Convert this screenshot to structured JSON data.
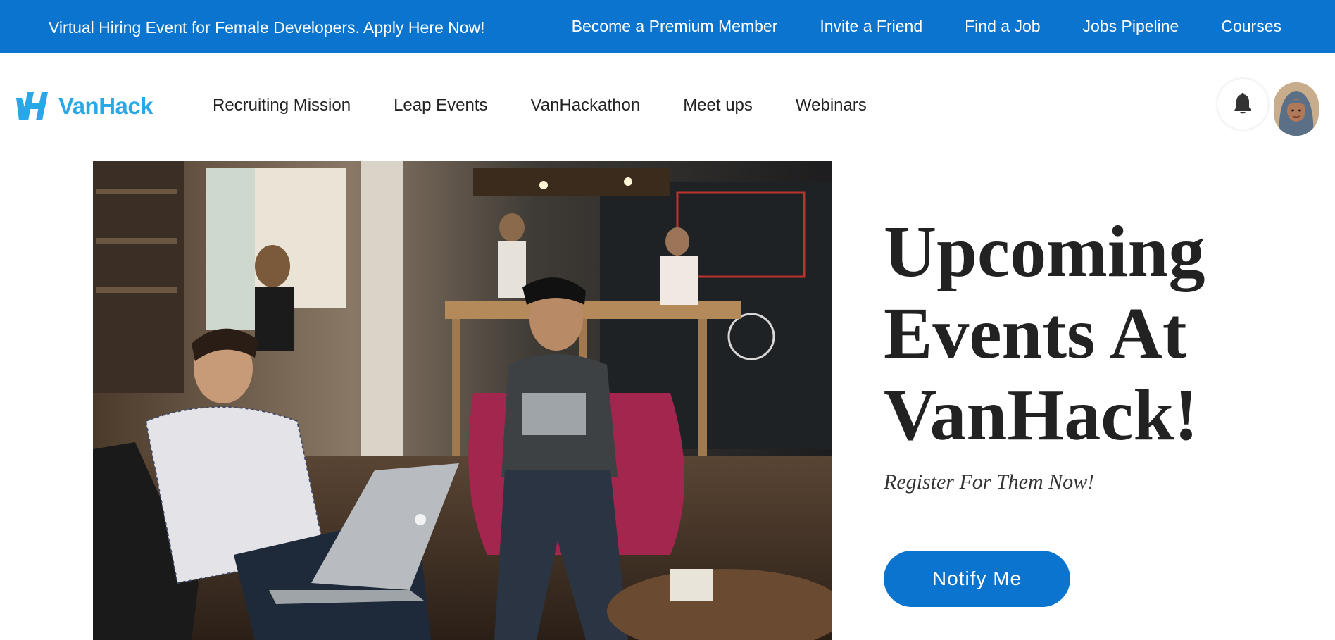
{
  "announcement": {
    "promo_text": "Virtual Hiring Event for Female Developers. Apply Here Now!"
  },
  "top_links": [
    {
      "label": "Become a Premium Member"
    },
    {
      "label": "Invite a Friend"
    },
    {
      "label": "Find a Job"
    },
    {
      "label": "Jobs Pipeline"
    },
    {
      "label": "Courses"
    }
  ],
  "brand": {
    "name": "VanHack",
    "color": "#29a8e8",
    "logo_icon": "vanhack-logo-icon"
  },
  "main_nav": [
    {
      "label": "Recruiting Mission"
    },
    {
      "label": "Leap Events"
    },
    {
      "label": "VanHackathon"
    },
    {
      "label": "Meet ups"
    },
    {
      "label": "Webinars"
    }
  ],
  "header_actions": {
    "notifications_icon": "bell-icon",
    "avatar_icon": "user-avatar"
  },
  "hero": {
    "title": "Upcoming Events At VanHack!",
    "subtitle": "Register For Them Now!",
    "button_label": "Notify Me",
    "image_description_icon": "coworking-cafe-photo"
  },
  "colors": {
    "primary": "#0b74cf",
    "text_dark": "#222222",
    "background": "#ffffff"
  }
}
